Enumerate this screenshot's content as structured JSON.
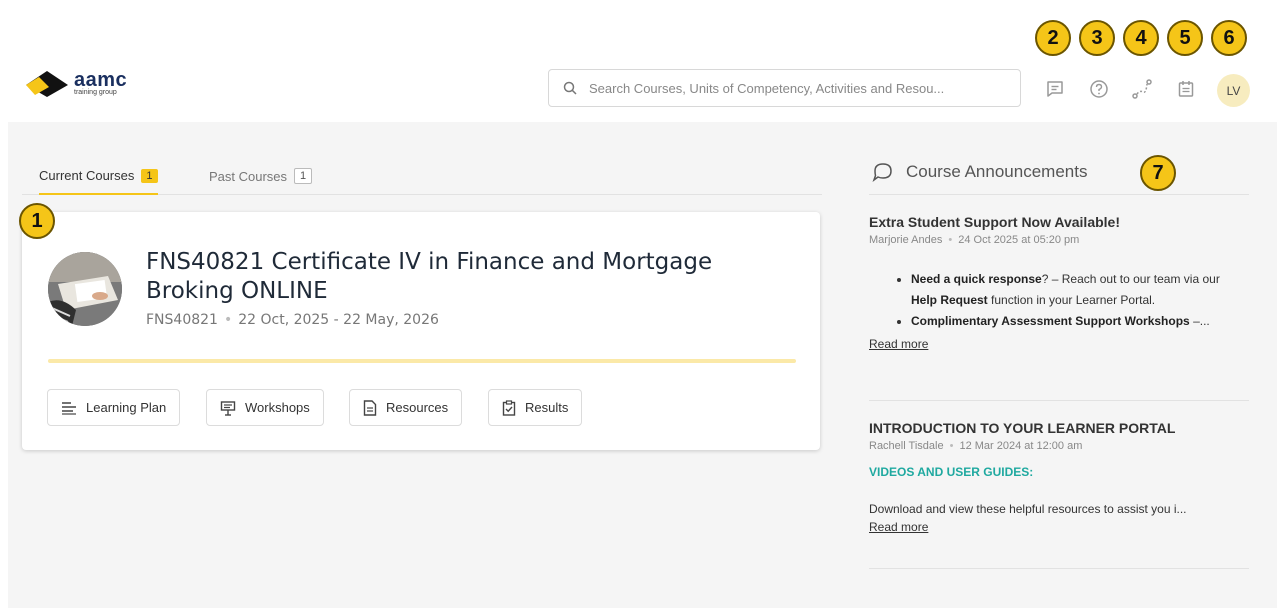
{
  "brand": {
    "name": "aamc",
    "tagline": "training group",
    "colors": {
      "navy": "#1a2f5f",
      "gold": "#f5c518",
      "teal": "#1fa9a0"
    }
  },
  "search": {
    "placeholder": "Search Courses, Units of Competency, Activities and Resou...",
    "icon": "search-icon"
  },
  "header_icons": [
    {
      "name": "message-icon",
      "callout": "2"
    },
    {
      "name": "help-icon",
      "callout": "3"
    },
    {
      "name": "path-icon",
      "callout": "4"
    },
    {
      "name": "calendar-icon",
      "callout": "5"
    }
  ],
  "user": {
    "initials": "LV",
    "callout": "6"
  },
  "tabs": [
    {
      "label": "Current Courses",
      "count": "1"
    },
    {
      "label": "Past Courses",
      "count": "1"
    }
  ],
  "course": {
    "callout": "1",
    "title": "FNS40821 Certificate IV in Finance and Mortgage Broking ONLINE",
    "code": "FNS40821",
    "dates": "22 Oct, 2025 - 22 May, 2026",
    "buttons": [
      {
        "label": "Learning Plan",
        "icon": "list-icon"
      },
      {
        "label": "Workshops",
        "icon": "presentation-icon"
      },
      {
        "label": "Resources",
        "icon": "document-icon"
      },
      {
        "label": "Results",
        "icon": "clipboard-check-icon"
      }
    ]
  },
  "announcements": {
    "callout": "7",
    "heading": "Course Announcements",
    "items": [
      {
        "title": "Extra Student Support Now Available!",
        "author": "Marjorie Andes",
        "date": "24 Oct 2025 at 05:20 pm",
        "bullet1_bold": "Need a quick response",
        "bullet1_text": "? – Reach out to our team via our ",
        "bullet1_bold2": "Help Request",
        "bullet1_text2": " function in your Learner Portal.",
        "bullet2_bold": "Complimentary Assessment Support Workshops",
        "bullet2_text": " –...",
        "read_more": "Read more"
      },
      {
        "title": "INTRODUCTION TO YOUR LEARNER PORTAL",
        "author": "Rachell Tisdale",
        "date": "12 Mar 2024 at 12:00 am",
        "subheading": "VIDEOS AND USER GUIDES:",
        "body": "Download and view these helpful resources to assist you i...",
        "read_more": "Read more"
      }
    ]
  }
}
